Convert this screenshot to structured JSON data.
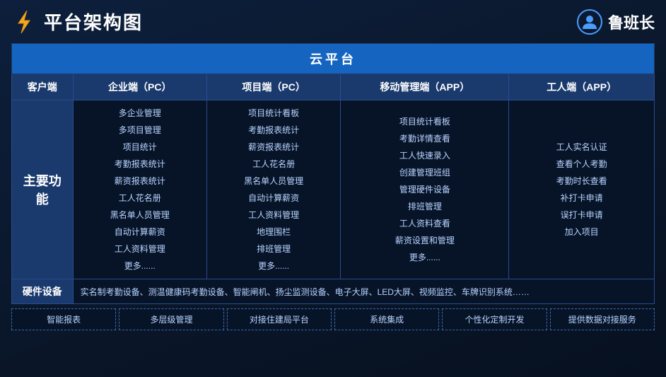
{
  "header": {
    "title": "平台架构图",
    "brand": "鲁班长"
  },
  "cloud_platform": "云平台",
  "columns": [
    {
      "label": "客户端"
    },
    {
      "label": "企业端（PC）"
    },
    {
      "label": "项目端（PC）"
    },
    {
      "label": "移动管理端（APP）"
    },
    {
      "label": "工人端（APP）"
    }
  ],
  "client_label": "主要功能",
  "enterprise_pc": [
    "多企业管理",
    "多项目管理",
    "项目统计",
    "考勤报表统计",
    "薪资报表统计",
    "工人花名册",
    "黑名单人员管理",
    "自动计算薪资",
    "工人资料管理",
    "更多......"
  ],
  "project_pc": [
    "项目统计看板",
    "考勤报表统计",
    "薪资报表统计",
    "工人花名册",
    "黑名单人员管理",
    "自动计算薪资",
    "工人资料管理",
    "地理围栏",
    "排班管理",
    "更多......"
  ],
  "mobile_app": [
    "项目统计看板",
    "考勤详情查看",
    "工人快速录入",
    "创建管理班组",
    "管理硬件设备",
    "排班管理",
    "工人资料查看",
    "薪资设置和管理",
    "更多......"
  ],
  "worker_app": [
    "工人实名认证",
    "查看个人考勤",
    "考勤时长查看",
    "补打卡申请",
    "误打卡申请",
    "加入项目"
  ],
  "hardware_label": "硬件设备",
  "hardware_content": "实名制考勤设备、测温健康码考勤设备、智能闸机、扬尘监测设备、电子大屏、LED大屏、视频监控、车牌识别系统……",
  "features": [
    "智能报表",
    "多层级管理",
    "对接住建局平台",
    "系统集成",
    "个性化定制开发",
    "提供数据对接服务"
  ]
}
